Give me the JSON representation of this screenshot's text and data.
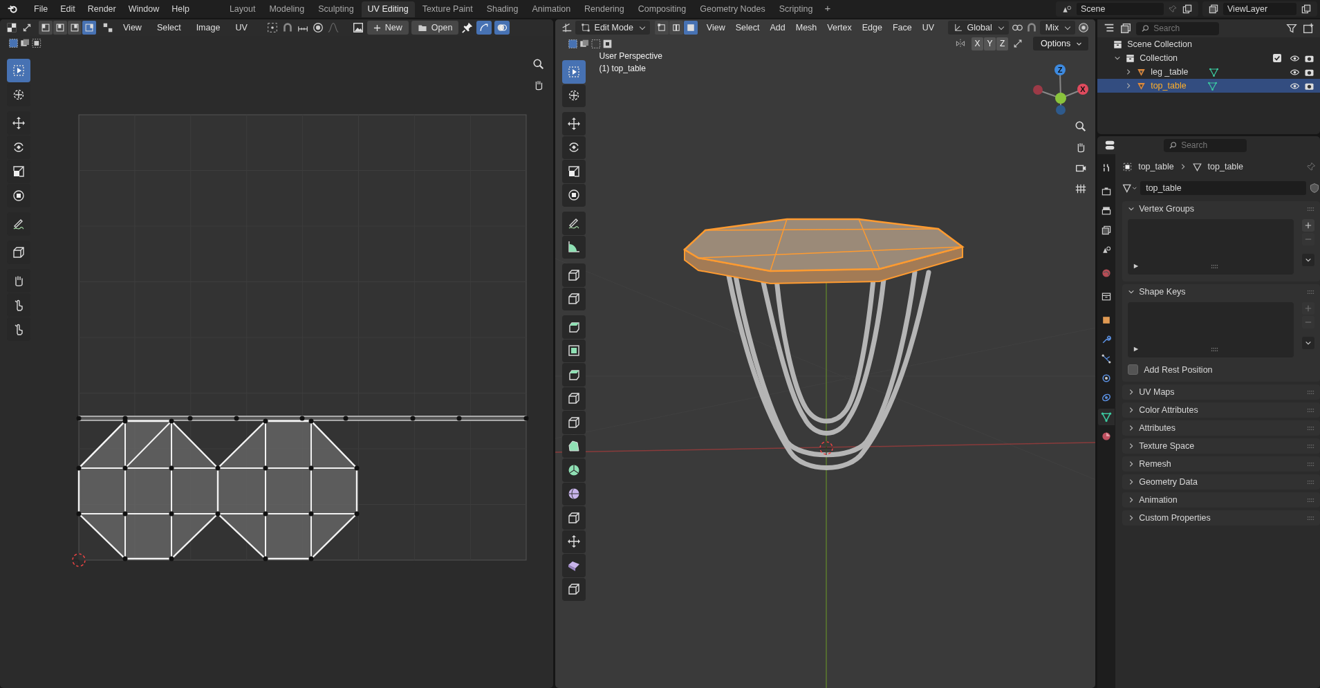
{
  "menu": [
    "File",
    "Edit",
    "Render",
    "Window",
    "Help"
  ],
  "workspaces": [
    {
      "label": "Layout",
      "selected": false
    },
    {
      "label": "Modeling",
      "selected": false
    },
    {
      "label": "Sculpting",
      "selected": false
    },
    {
      "label": "UV Editing",
      "selected": true
    },
    {
      "label": "Texture Paint",
      "selected": false
    },
    {
      "label": "Shading",
      "selected": false
    },
    {
      "label": "Animation",
      "selected": false
    },
    {
      "label": "Rendering",
      "selected": false
    },
    {
      "label": "Compositing",
      "selected": false
    },
    {
      "label": "Geometry Nodes",
      "selected": false
    },
    {
      "label": "Scripting",
      "selected": false
    }
  ],
  "add_workspace": "+",
  "scene": {
    "name": "Scene"
  },
  "view_layer": {
    "name": "ViewLayer"
  },
  "uv_editor": {
    "menus": [
      "View",
      "Select",
      "Image",
      "UV"
    ],
    "new_button": "New",
    "open_button": "Open",
    "select_modes": [
      {
        "selected": false
      },
      {
        "selected": false
      },
      {
        "selected": false
      },
      {
        "selected": true
      }
    ],
    "tools": [
      {
        "selected": true
      },
      {
        "selected": false
      },
      {
        "selected": false
      },
      {
        "selected": false
      },
      {
        "selected": false
      },
      {
        "selected": false
      },
      {
        "selected": false
      },
      {
        "selected": false
      },
      {
        "selected": false
      },
      {
        "selected": false
      },
      {
        "selected": false
      }
    ]
  },
  "viewport": {
    "mode": "Edit Mode",
    "menus": [
      "View",
      "Select",
      "Add",
      "Mesh",
      "Vertex",
      "Edge",
      "Face",
      "UV"
    ],
    "orientation": "Global",
    "proportional": "Mix",
    "mirror_axes": [
      "X",
      "Y",
      "Z"
    ],
    "options": "Options",
    "select_modes": [
      {
        "selected": false
      },
      {
        "selected": false
      },
      {
        "selected": true
      }
    ],
    "overlay_title": "User Perspective",
    "overlay_object": "(1) top_table",
    "gizmo_labels": [
      "Z",
      "X"
    ],
    "tools": [
      {
        "selected": true
      },
      {
        "selected": false
      },
      {
        "selected": false
      },
      {
        "selected": false
      },
      {
        "selected": false
      },
      {
        "selected": false
      },
      {
        "selected": false
      },
      {
        "selected": false
      },
      {
        "selected": false
      },
      {
        "selected": false
      },
      {
        "selected": false
      },
      {
        "selected": false
      },
      {
        "selected": false
      },
      {
        "selected": false
      },
      {
        "selected": false
      },
      {
        "selected": false
      },
      {
        "selected": false
      },
      {
        "selected": false
      },
      {
        "selected": false
      },
      {
        "selected": false
      },
      {
        "selected": false
      },
      {
        "selected": false
      }
    ]
  },
  "outliner": {
    "search_placeholder": "Search",
    "root": "Scene Collection",
    "collection": {
      "label": "Collection",
      "expanded": true,
      "checked": true
    },
    "objects": [
      {
        "name": "leg _table",
        "selected": false
      },
      {
        "name": "top_table",
        "selected": true
      }
    ]
  },
  "properties": {
    "search_placeholder": "Search",
    "breadcrumb": [
      "top_table",
      "top_table"
    ],
    "mesh_name": "top_table",
    "tabs": [
      {
        "selected": false
      },
      {
        "selected": false
      },
      {
        "selected": false
      },
      {
        "selected": false
      },
      {
        "selected": false
      },
      {
        "selected": false
      },
      {
        "selected": false
      },
      {
        "selected": false
      },
      {
        "selected": false
      },
      {
        "selected": false
      },
      {
        "selected": false
      },
      {
        "selected": false
      },
      {
        "selected": true
      },
      {
        "selected": false
      }
    ],
    "panels": [
      {
        "title": "Vertex Groups",
        "expanded": true,
        "kind": "list"
      },
      {
        "title": "Shape Keys",
        "expanded": true,
        "kind": "list",
        "checkbox": {
          "label": "Add Rest Position",
          "checked": false
        }
      },
      {
        "title": "UV Maps",
        "expanded": false
      },
      {
        "title": "Color Attributes",
        "expanded": false
      },
      {
        "title": "Attributes",
        "expanded": false
      },
      {
        "title": "Texture Space",
        "expanded": false
      },
      {
        "title": "Remesh",
        "expanded": false
      },
      {
        "title": "Geometry Data",
        "expanded": false
      },
      {
        "title": "Animation",
        "expanded": false
      },
      {
        "title": "Custom Properties",
        "expanded": false
      }
    ]
  }
}
